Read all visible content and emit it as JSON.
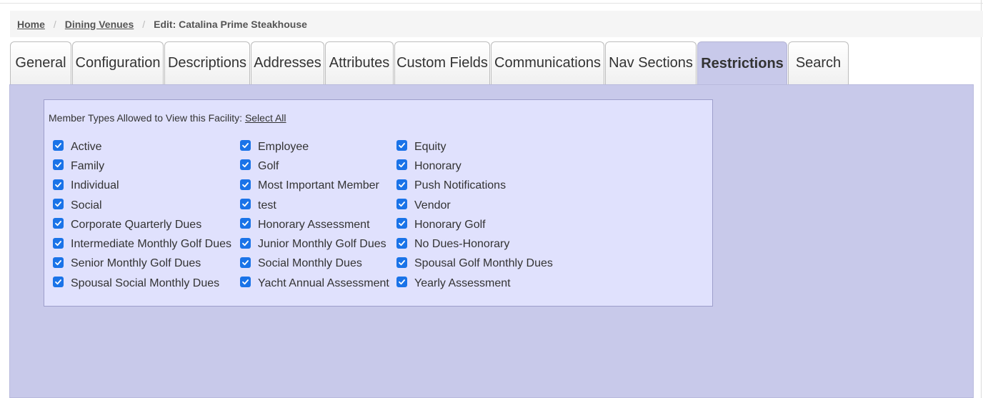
{
  "breadcrumb": {
    "home": "Home",
    "separator": "/",
    "dining": "Dining Venues",
    "current": "Edit: Catalina Prime Steakhouse"
  },
  "tabs": [
    {
      "label": "General",
      "active": false
    },
    {
      "label": "Configuration",
      "active": false
    },
    {
      "label": "Descriptions",
      "active": false
    },
    {
      "label": "Addresses",
      "active": false
    },
    {
      "label": "Attributes",
      "active": false
    },
    {
      "label": "Custom Fields",
      "active": false
    },
    {
      "label": "Communications",
      "active": false
    },
    {
      "label": "Nav Sections",
      "active": false
    },
    {
      "label": "Restrictions",
      "active": true
    },
    {
      "label": "Search",
      "active": false
    }
  ],
  "restrictions": {
    "heading": "Member Types Allowed to View this Facility:",
    "select_all": "Select All",
    "columns": [
      [
        "Active",
        "Family",
        "Individual",
        "Social",
        "Corporate Quarterly Dues",
        "Intermediate Monthly Golf Dues",
        "Senior Monthly Golf Dues",
        "Spousal Social Monthly Dues"
      ],
      [
        "Employee",
        "Golf",
        "Most Important Member",
        "test",
        "Honorary Assessment",
        "Junior Monthly Golf Dues",
        "Social Monthly Dues",
        "Yacht Annual Assessment"
      ],
      [
        "Equity",
        "Honorary",
        "Push Notifications",
        "Vendor",
        "Honorary Golf",
        "No Dues-Honorary",
        "Spousal Golf Monthly Dues",
        "Yearly Assessment"
      ]
    ],
    "all_checked": true
  },
  "colors": {
    "panel": "#c8c9ea",
    "fieldset": "#e0e1fd",
    "checkbox": "#1a73e8"
  },
  "icons": {
    "checkbox": "check-icon"
  }
}
